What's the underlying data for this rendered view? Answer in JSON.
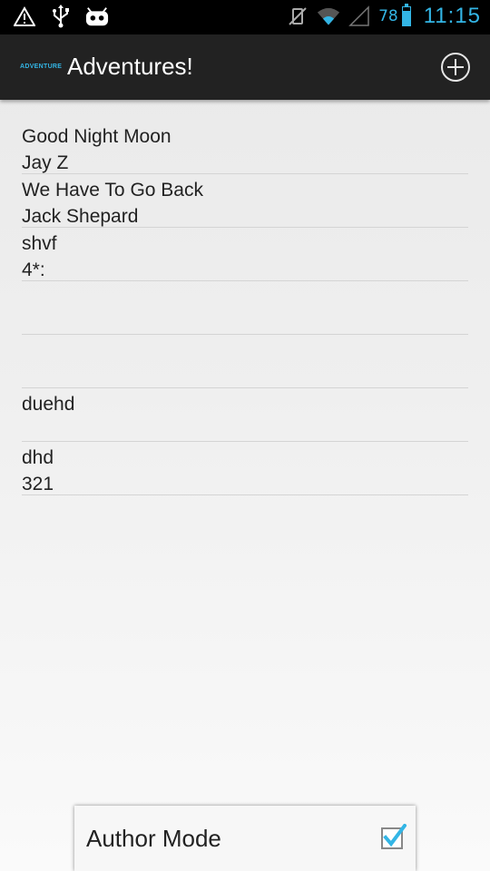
{
  "status_bar": {
    "icons": [
      "warning-icon",
      "usb-icon",
      "cyanogen-android-icon",
      "vibrate-mute-icon",
      "wifi-icon",
      "signal-icon",
      "battery-icon"
    ],
    "battery_percent": "78",
    "battery_level": 0.78,
    "time": "11:15",
    "accent_color": "#33b5e5"
  },
  "action_bar": {
    "logo_text": "ADVENTURE",
    "title": "Adventures!",
    "add_icon": "plus-circle-icon"
  },
  "adventures": [
    {
      "title": "Good Night Moon",
      "author": "Jay Z"
    },
    {
      "title": "We Have To Go Back",
      "author": "Jack Shepard"
    },
    {
      "title": "shvf",
      "author": "4*:"
    },
    {
      "title": "",
      "author": ""
    },
    {
      "title": "",
      "author": ""
    },
    {
      "title": "duehd",
      "author": ""
    },
    {
      "title": "dhd",
      "author": "321"
    }
  ],
  "author_mode": {
    "label": "Author Mode",
    "checked": true
  }
}
